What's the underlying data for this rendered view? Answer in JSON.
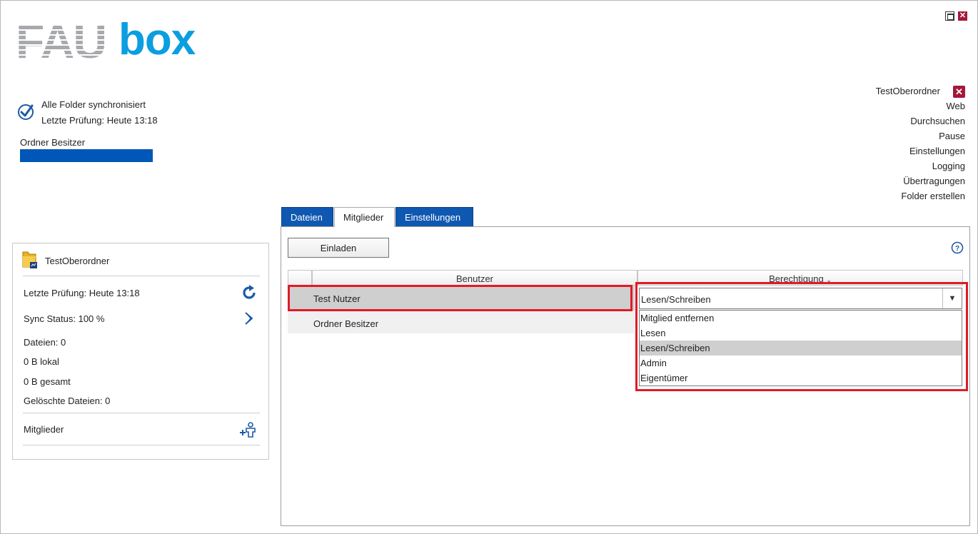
{
  "logo": {
    "part1": "FAU",
    "part2": "box"
  },
  "status": {
    "main": "Alle Folder synchronisiert",
    "last_check": "Letzte Prüfung: Heute 13:18",
    "owner_label": "Ordner Besitzer"
  },
  "menu": {
    "folder": "TestOberordner",
    "items": [
      "Web",
      "Durchsuchen",
      "Pause",
      "Einstellungen",
      "Logging",
      "Übertragungen",
      "Folder erstellen"
    ]
  },
  "folder_panel": {
    "name": "TestOberordner",
    "last_check": "Letzte Prüfung: Heute 13:18",
    "sync_status": "Sync Status: 100 %",
    "files": "Dateien: 0",
    "local": "0 B lokal",
    "total": "0 B gesamt",
    "deleted": "Gelöschte Dateien: 0",
    "members": "Mitglieder"
  },
  "tabs": [
    "Dateien",
    "Mitglieder",
    "Einstellungen"
  ],
  "toolbar": {
    "invite_label": "Einladen"
  },
  "table": {
    "headers": {
      "user": "Benutzer",
      "permission": "Berechtigung"
    },
    "rows": [
      {
        "user": "Test Nutzer"
      },
      {
        "user": "Ordner Besitzer"
      }
    ]
  },
  "dropdown": {
    "selected": "Lesen/Schreiben",
    "options": [
      "Mitglied entfernen",
      "Lesen",
      "Lesen/Schreiben",
      "Admin",
      "Eigentümer"
    ]
  },
  "colors": {
    "accent_blue": "#0f58b1",
    "logo_blue": "#0b9ee0",
    "close_red": "#a5183a",
    "highlight_red": "#e11a26"
  }
}
